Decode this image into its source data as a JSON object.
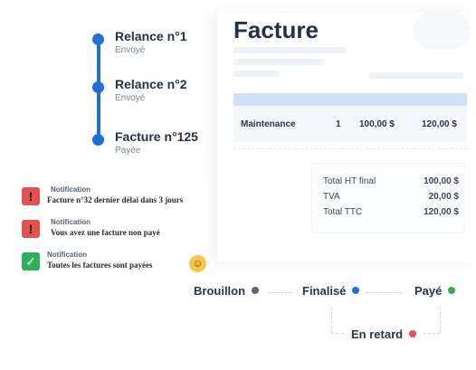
{
  "timeline": {
    "items": [
      {
        "title": "Relance n°1",
        "subtitle": "Envoyé"
      },
      {
        "title": "Relance n°2",
        "subtitle": "Envoyé"
      },
      {
        "title": "Facture n°125",
        "subtitle": "Payée"
      }
    ],
    "accent": "#1f6fd6"
  },
  "invoice": {
    "title": "Facture",
    "line": {
      "description": "Maintenance",
      "quantity": "1",
      "unit_price": "100,00 $",
      "total": "120,00 $"
    },
    "totals": [
      {
        "label": "Total HT final",
        "value": "100,00 $"
      },
      {
        "label": "TVA",
        "value": "20,00 $"
      },
      {
        "label": "Total TTC",
        "value": "120,00 $"
      }
    ]
  },
  "notifications": [
    {
      "heading": "Notification",
      "message": "Facture n°32 dernier délai dans 3 jours",
      "icon": "exclamation-icon",
      "type": "error"
    },
    {
      "heading": "Notification",
      "message": "Vous avez une facture non  payé",
      "icon": "exclamation-icon",
      "type": "error"
    },
    {
      "heading": "Notification",
      "message": "Toutes les factures sont payées",
      "icon": "check-icon",
      "type": "success"
    }
  ],
  "statuses": [
    {
      "label": "Brouillon",
      "color": "#5b6478"
    },
    {
      "label": "Finalisé",
      "color": "#1f6fd6"
    },
    {
      "label": "Payé",
      "color": "#2fae5b"
    },
    {
      "label": "En retard",
      "color": "#e2524f"
    }
  ]
}
